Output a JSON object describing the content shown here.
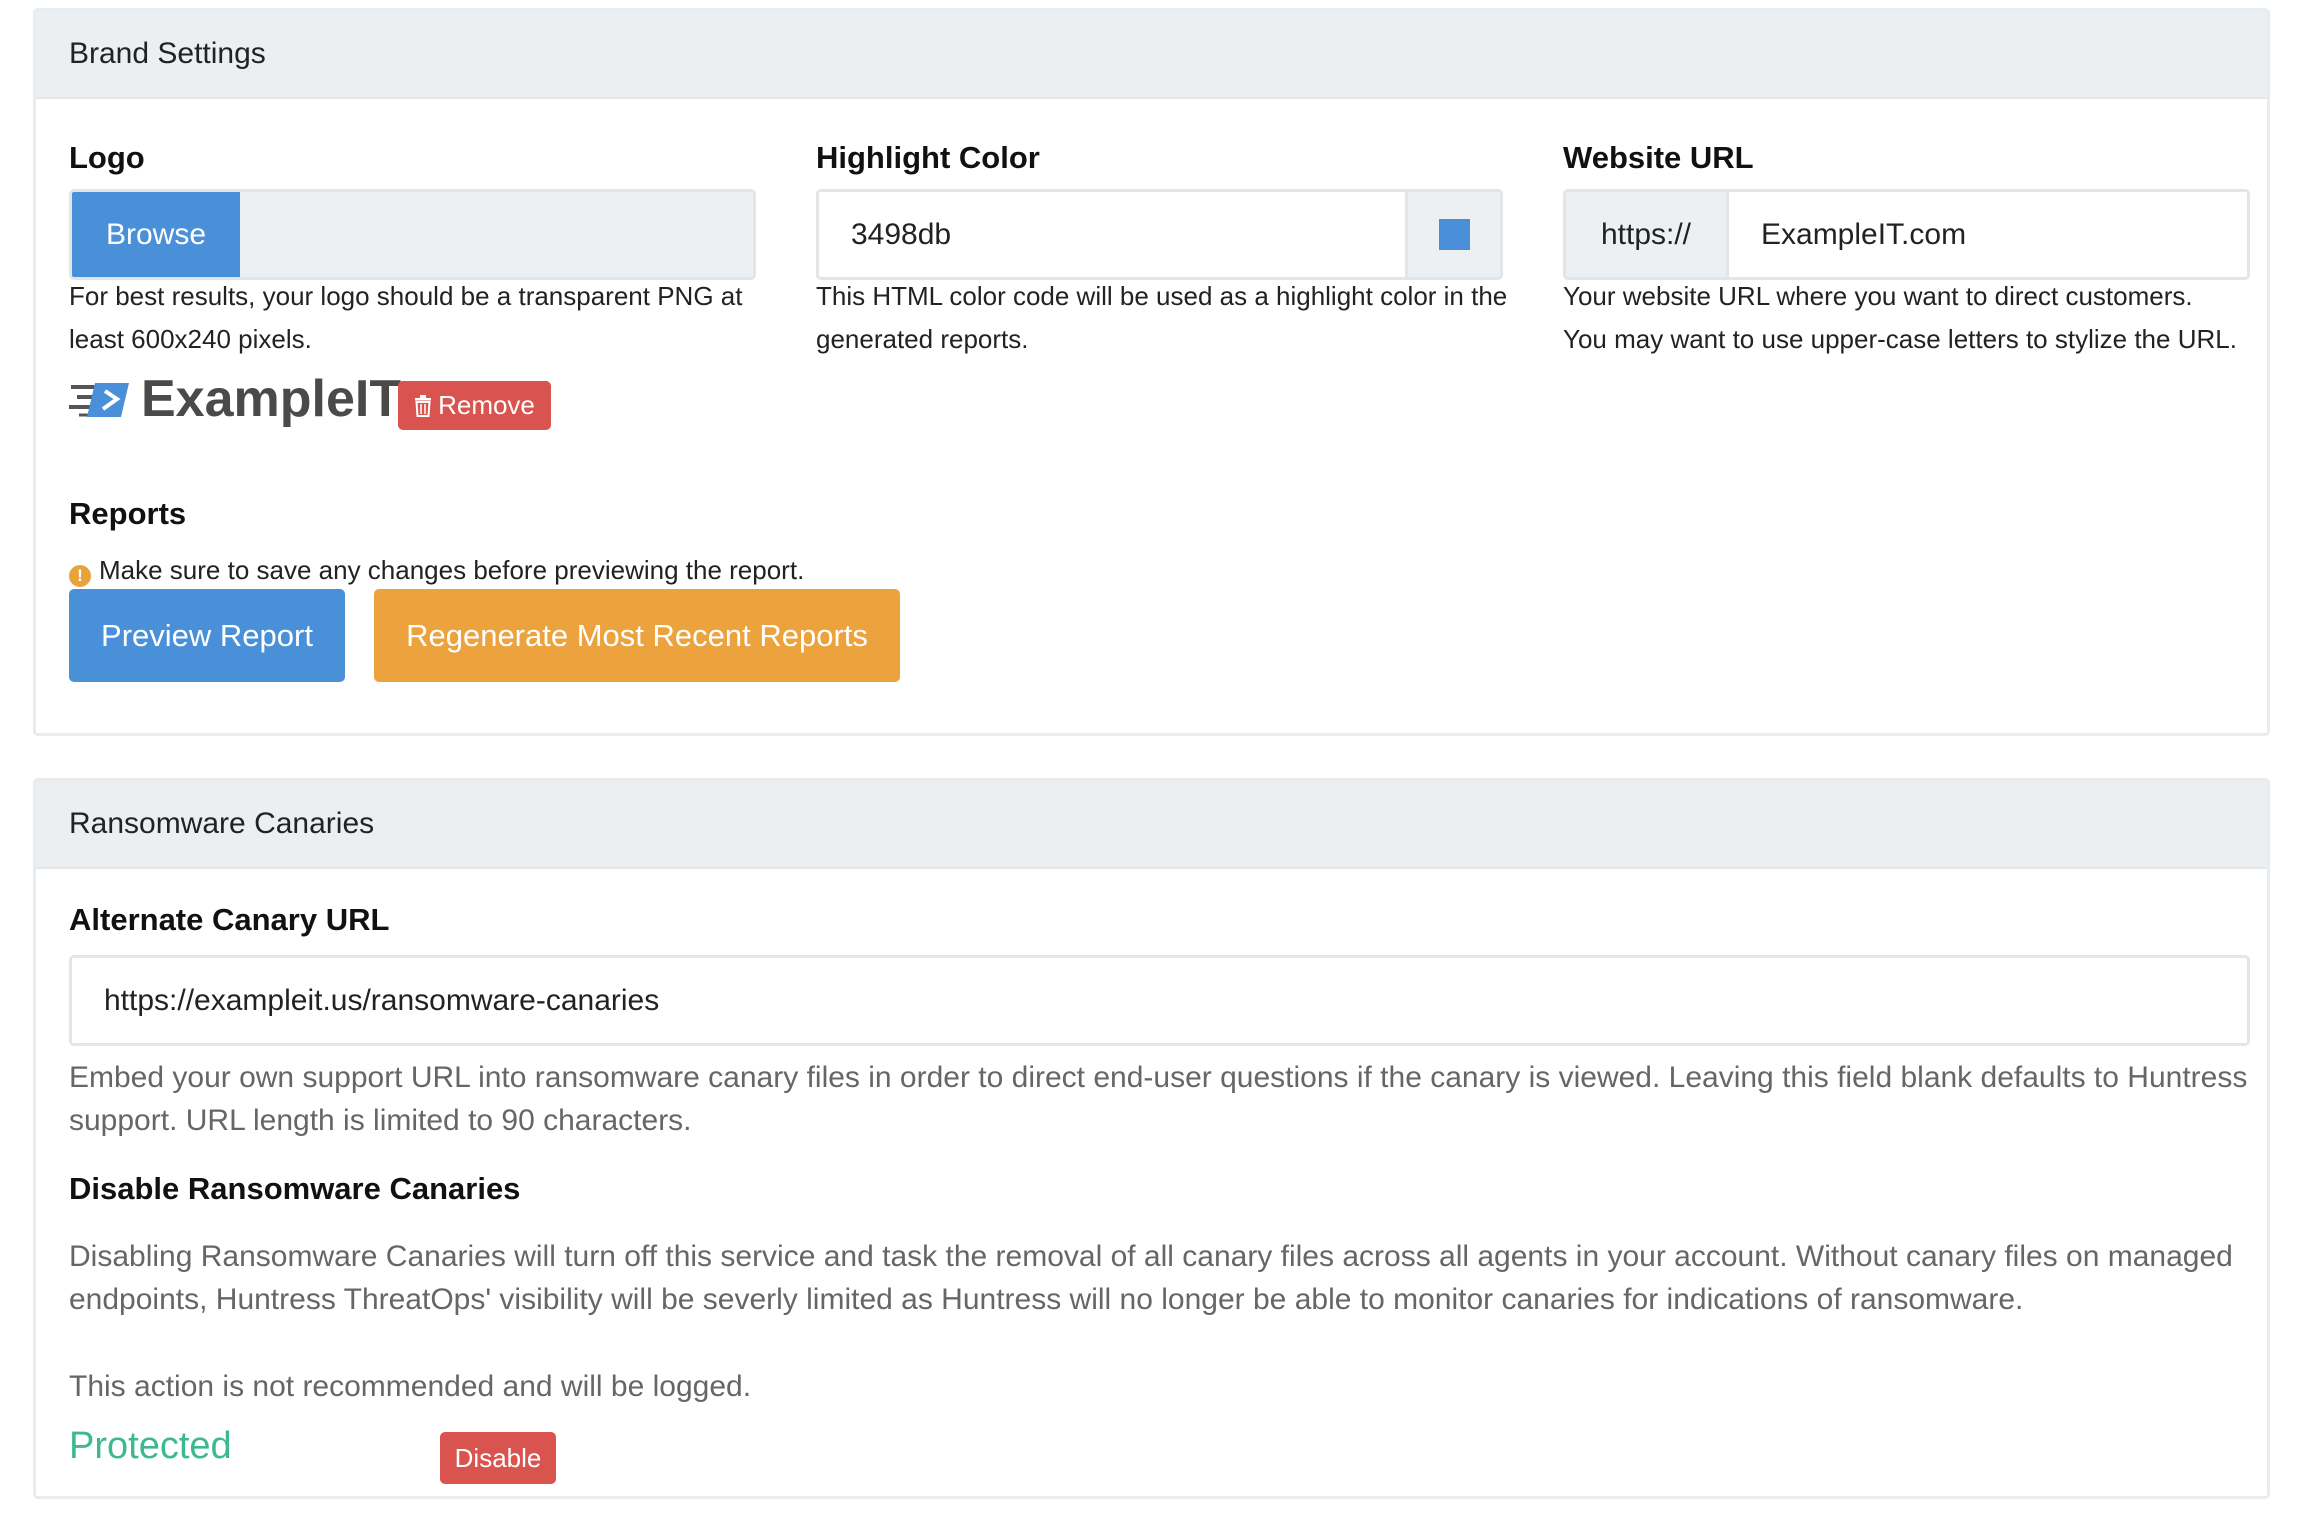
{
  "brand": {
    "heading": "Brand Settings",
    "logo": {
      "label": "Logo",
      "browse_label": "Browse",
      "help": "For best results, your logo should be a transparent PNG at least 600x240 pixels.",
      "logo_text": "ExampleIT",
      "remove_label": "Remove"
    },
    "highlight": {
      "label": "Highlight Color",
      "value": "3498db",
      "swatch_color": "#4a90d9",
      "help": "This HTML color code will be used as a highlight color in the generated reports."
    },
    "website": {
      "label": "Website URL",
      "prefix": "https://",
      "value": "ExampleIT.com",
      "help_line1": "Your website URL where you want to direct customers.",
      "help_line2": "You may want to use upper-case letters to stylize the URL."
    },
    "reports": {
      "label": "Reports",
      "warning": "Make sure to save any changes before previewing the report.",
      "preview_label": "Preview Report",
      "regenerate_label": "Regenerate Most Recent Reports"
    }
  },
  "canaries": {
    "heading": "Ransomware Canaries",
    "alt_url": {
      "label": "Alternate Canary URL",
      "value": "https://exampleit.us/ransomware-canaries",
      "help": "Embed your own support URL into ransomware canary files in order to direct end-user questions if the canary is viewed. Leaving this field blank defaults to Huntress support. URL length is limited to 90 characters."
    },
    "disable": {
      "label": "Disable Ransomware Canaries",
      "description": "Disabling Ransomware Canaries will turn off this service and task the removal of all canary files across all agents in your account. Without canary files on managed endpoints, Huntress ThreatOps' visibility will be severly limited as Huntress will no longer be able to monitor canaries for indications of ransomware.",
      "note": "This action is not recommended and will be logged.",
      "status": "Protected",
      "disable_label": "Disable"
    }
  },
  "colors": {
    "primary": "#4a90d9",
    "warning": "#eca23d",
    "danger": "#d9534f",
    "success": "#3cb98f"
  }
}
